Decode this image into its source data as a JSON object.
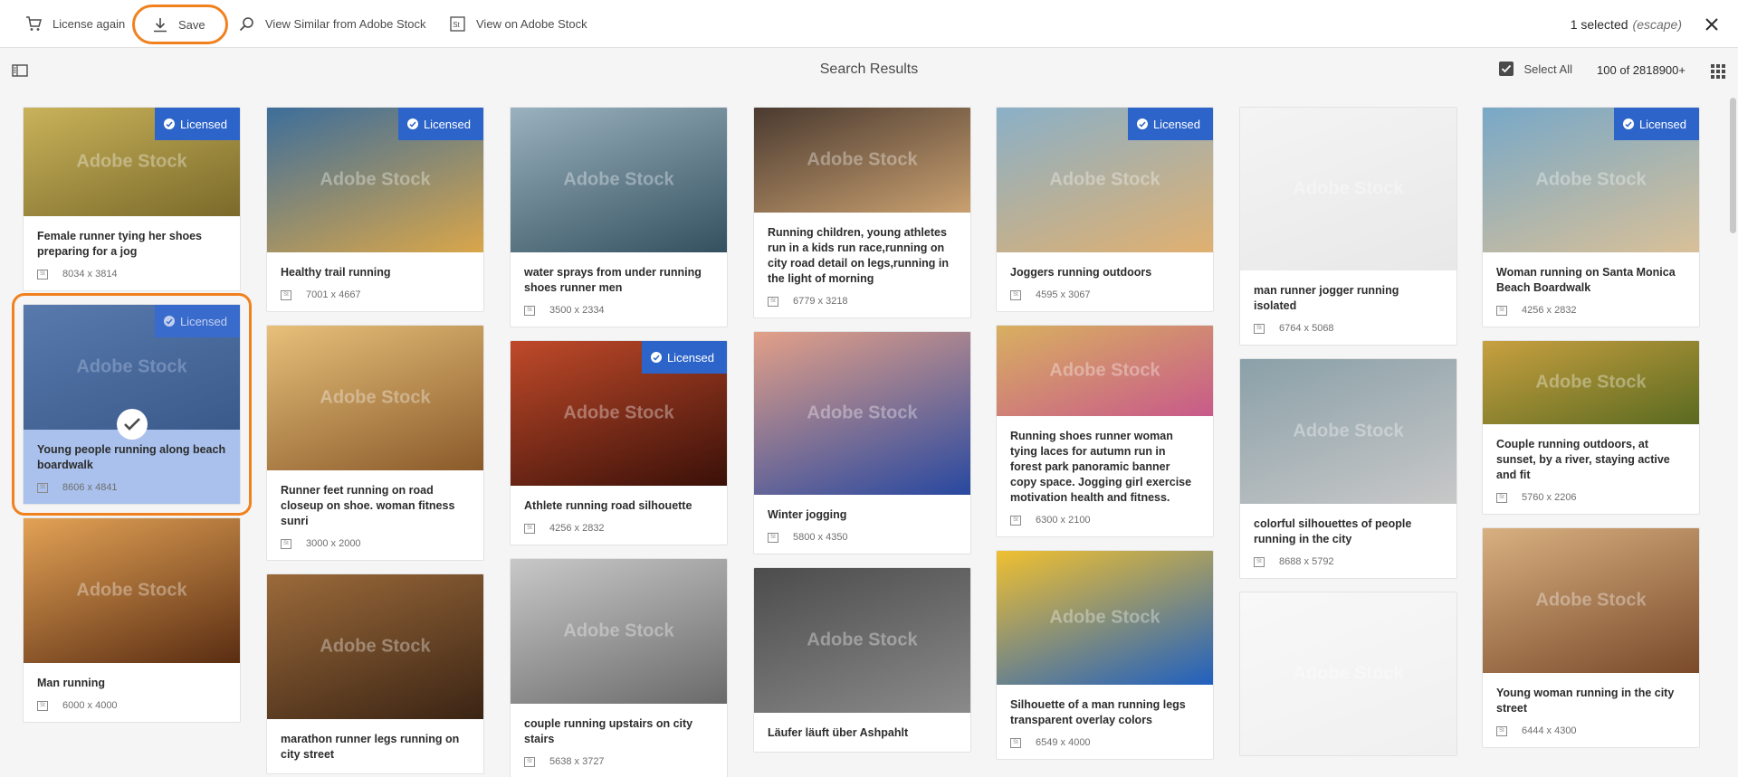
{
  "actionbar": {
    "license_again": "License again",
    "save": "Save",
    "view_similar": "View Similar from Adobe Stock",
    "view_on_stock": "View on Adobe Stock",
    "selected_count": "1 selected",
    "escape_hint": "(escape)"
  },
  "subbar": {
    "title": "Search Results",
    "select_all": "Select All",
    "result_count": "100 of 2818900+"
  },
  "licensed_label": "Licensed",
  "watermark": "Adobe Stock",
  "columns": [
    [
      {
        "title": "Female runner tying her shoes preparing for a jog",
        "dims": "8034 x 3814",
        "licensed": true
      },
      {
        "title": "Young people running along beach boardwalk",
        "dims": "8606 x 4841",
        "licensed": true,
        "selected": true
      },
      {
        "title": "Man running",
        "dims": "6000 x 4000",
        "licensed": false
      }
    ],
    [
      {
        "title": "Healthy trail running",
        "dims": "7001 x 4667",
        "licensed": true
      },
      {
        "title": "Runner feet running on road closeup on shoe. woman fitness sunri",
        "dims": "3000 x 2000",
        "licensed": false
      },
      {
        "title": "marathon runner legs running on city street",
        "dims": "",
        "licensed": false
      }
    ],
    [
      {
        "title": "water sprays from under running shoes runner men",
        "dims": "3500 x 2334",
        "licensed": false
      },
      {
        "title": "Athlete running road silhouette",
        "dims": "4256 x 2832",
        "licensed": true
      },
      {
        "title": "couple running upstairs on city stairs",
        "dims": "5638 x 3727",
        "licensed": false
      }
    ],
    [
      {
        "title": "Running children, young athletes run in a kids run race,running on city road detail on legs,running in the light of morning",
        "dims": "6779 x 3218",
        "licensed": false
      },
      {
        "title": "Winter jogging",
        "dims": "5800 x 4350",
        "licensed": false
      },
      {
        "title": "Läufer läuft über Ashpahlt",
        "dims": "",
        "licensed": false
      }
    ],
    [
      {
        "title": "Joggers running outdoors",
        "dims": "4595 x 3067",
        "licensed": true
      },
      {
        "title": "Running shoes runner woman tying laces for autumn run in forest park panoramic banner copy space. Jogging girl exercise motivation health and fitness.",
        "dims": "6300 x 2100",
        "licensed": false
      },
      {
        "title": "Silhouette of a man running legs transparent overlay colors",
        "dims": "6549 x 4000",
        "licensed": false
      }
    ],
    [
      {
        "title": "man runner jogger running isolated",
        "dims": "6764 x 5068",
        "licensed": false
      },
      {
        "title": "colorful silhouettes of people running in the city",
        "dims": "8688 x 5792",
        "licensed": false
      },
      {
        "title": "",
        "dims": "",
        "licensed": false
      }
    ],
    [
      {
        "title": "Woman running on Santa Monica Beach Boardwalk",
        "dims": "4256 x 2832",
        "licensed": true
      },
      {
        "title": "Couple running outdoors, at sunset, by a river, staying active and fit",
        "dims": "5760 x 2206",
        "licensed": false
      },
      {
        "title": "Young woman running in the city street",
        "dims": "6444 x 4300",
        "licensed": false
      }
    ]
  ],
  "colors": {
    "accent_orange": "#f0811e",
    "licensed_blue": "#2d64c9",
    "selected_fill": "#a9c1ec"
  },
  "icons": [
    "cart-icon",
    "download-icon",
    "search-icon",
    "stock-icon",
    "close-icon",
    "rail-toggle-icon",
    "checkbox-icon",
    "grid-view-icon",
    "check-icon"
  ]
}
